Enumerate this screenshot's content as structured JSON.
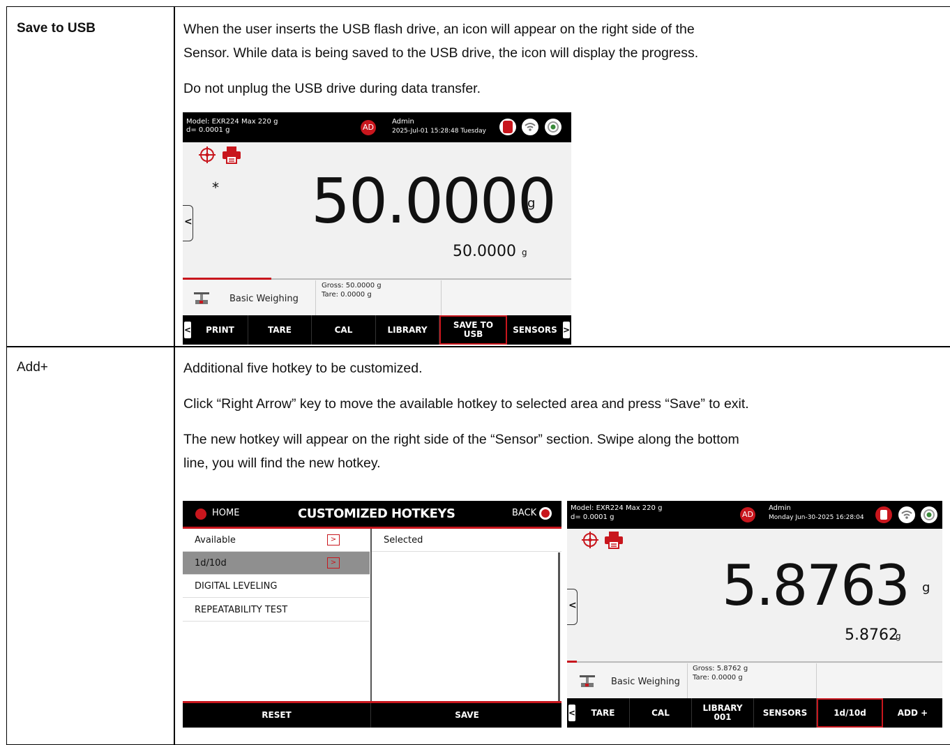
{
  "rows": [
    {
      "label": "Save to USB",
      "paragraphs": [
        "When the user inserts the USB flash drive, an icon will appear on the right side of the",
        "Sensor.  While data is being saved to the USB drive, the icon will display the progress.",
        "Do not unplug the USB drive during data transfer."
      ],
      "screen": {
        "model": "Model: EXR224   Max 220 g",
        "division": "d= 0.0001 g",
        "avatar": "AD",
        "user": "Admin",
        "datetime": "2025-Jul-01 15:28:48 Tuesday",
        "asterisk": "*",
        "main_value": "50.0000",
        "main_unit": "g",
        "secondary_value": "50.0000",
        "secondary_unit": "g",
        "mode": "Basic Weighing",
        "gross": "Gross: 50.0000 g",
        "tare": "Tare: 0.0000 g",
        "hotkeys": [
          "PRINT",
          "TARE",
          "CAL",
          "LIBRARY",
          "SAVE TO\nUSB",
          "SENSORS"
        ],
        "selected_hotkey": "SAVE TO\nUSB"
      }
    },
    {
      "label": "Add+",
      "paragraphs": [
        "Additional five hotkey to be customized.",
        "Click “Right Arrow” key to move the available hotkey to selected area and press “Save” to exit.",
        "The new hotkey will appear on the right side of the “Sensor” section. Swipe along the bottom",
        "line, you will find the new hotkey."
      ],
      "hotkey_screen": {
        "home": "HOME",
        "title": "CUSTOMIZED HOTKEYS",
        "back": "BACK",
        "available_header": "Available",
        "selected_header": "Selected",
        "available_items": [
          "1d/10d",
          "DIGITAL LEVELING",
          "REPEATABILITY TEST"
        ],
        "reset": "RESET",
        "save": "SAVE"
      },
      "screen": {
        "model": "Model: EXR224   Max 220 g",
        "division": "d= 0.0001 g",
        "avatar": "AD",
        "user": "Admin",
        "datetime": "Monday Jun-30-2025 16:28:04",
        "main_value": "5.8763",
        "main_unit": "g",
        "secondary_value": "5.8762",
        "secondary_unit": "g",
        "mode": "Basic Weighing",
        "gross": "Gross: 5.8762 g",
        "tare": "Tare: 0.0000 g",
        "hotkeys": [
          "TARE",
          "CAL",
          "LIBRARY\n001",
          "SENSORS",
          "1d/10d",
          "ADD +"
        ],
        "selected_hotkey": "1d/10d"
      }
    }
  ],
  "icons": {
    "target": "crosshair-icon",
    "printer": "printer-icon",
    "usb": "usb-drive-icon",
    "wifi": "wifi-icon",
    "status": "status-icon",
    "home": "home-icon",
    "back": "back-icon",
    "chevron_left": "chevron-left-icon",
    "chevron_right": "chevron-right-icon",
    "scale": "scale-icon"
  },
  "colors": {
    "accent": "#c8161d",
    "bar": "#000000",
    "panel": "#f1f1f1"
  }
}
